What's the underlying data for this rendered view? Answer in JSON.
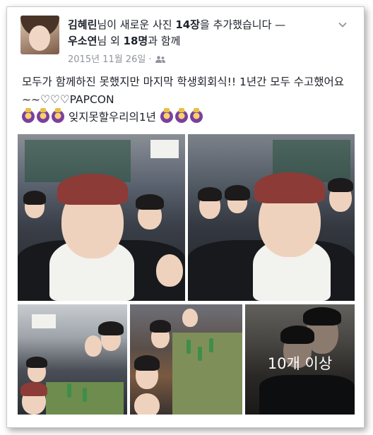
{
  "post": {
    "author": "김혜린",
    "action_suffix": "님이 새로운 사진 ",
    "photo_count": "14장",
    "action_end": "을 추가했습니다 —",
    "tagged_user": "우소연",
    "tagged_mid": "님 외 ",
    "tagged_count": "18명",
    "tagged_end": "과 함께",
    "date": "2015년 11월 26일",
    "meta_separator": "·",
    "audience_icon": "friends-icon",
    "body_text": "모두가 함께하진 못했지만 마지막 학생회회식!! 1년간 모두 수고했어요~~♡♡♡PAPCON",
    "emoji_caption": "잊지못할우리의1년",
    "emoji_icon": "crowned-emoji-icon"
  },
  "photos": {
    "more_label": "10개 이상"
  },
  "colors": {
    "text": "#1d2129",
    "meta": "#90949c",
    "card_border": "#c9c9c9",
    "overlay_text": "#ffffff"
  }
}
